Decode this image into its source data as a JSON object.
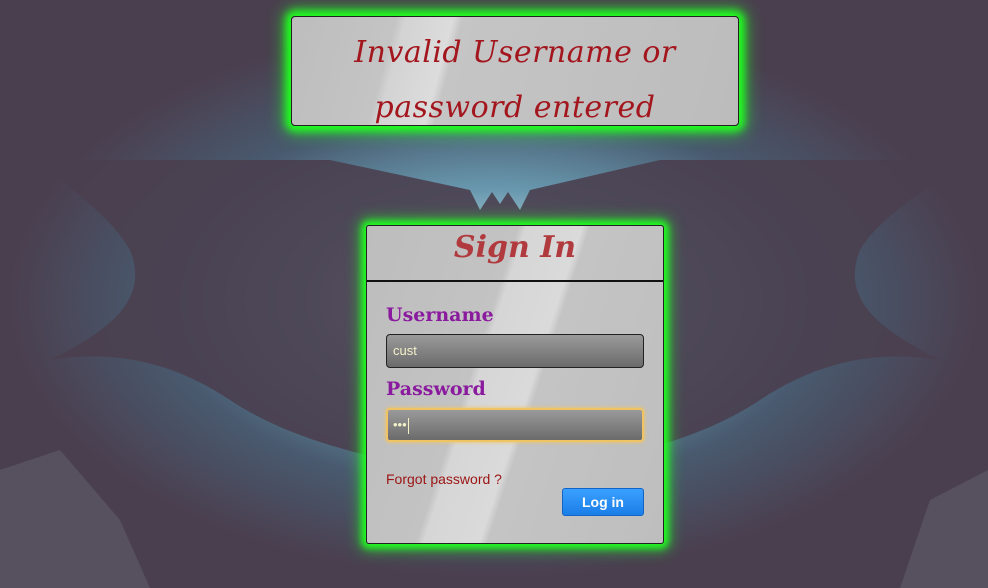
{
  "alert": {
    "message": "Invalid Username or password entered"
  },
  "login": {
    "title": "Sign In",
    "username_label": "Username",
    "username_value": "cust",
    "password_label": "Password",
    "password_value": "•••",
    "forgot_link": "Forgot password ?",
    "login_button": "Log in"
  },
  "colors": {
    "background": "#4a3f4f",
    "panel_glow": "#20ff20",
    "alert_text": "#a3161d",
    "title_text": "#b03a3e",
    "label_text": "#8a1a9e",
    "button": "#1a7ee8"
  },
  "icons": {
    "background": "bat-emblem"
  }
}
